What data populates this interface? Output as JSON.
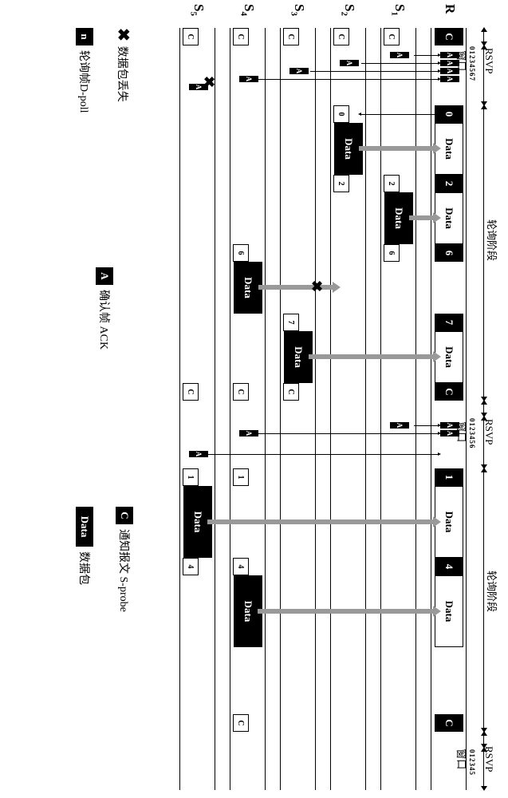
{
  "phases": {
    "rsvp1": {
      "label_top": "RSVP",
      "label_bot": "窗口",
      "ticks": "01234567"
    },
    "poll1": {
      "label": "轮询阶段"
    },
    "rsvp2": {
      "label_top": "RSVP",
      "label_bot": "窗口",
      "ticks": "0123456"
    },
    "poll2": {
      "label": "轮询阶段"
    },
    "rsvp3": {
      "label_top": "RSVP",
      "label_bot": "窗口",
      "ticks": "012345"
    }
  },
  "rows": {
    "R": {
      "label": "R"
    },
    "S1": {
      "label": "S",
      "sub": "1"
    },
    "S2": {
      "label": "S",
      "sub": "2"
    },
    "S3": {
      "label": "S",
      "sub": "3"
    },
    "S4": {
      "label": "S",
      "sub": "4"
    },
    "S5": {
      "label": "S",
      "sub": "5"
    }
  },
  "blocks": {
    "c": "C",
    "data": "Data",
    "a": "A",
    "poll_nums": {
      "n0": "0",
      "n2": "2",
      "n6": "6",
      "n7": "7",
      "n1": "1",
      "n4": "4"
    }
  },
  "legend": {
    "x_loss": "数据包丢失",
    "dpoll": "轮询帧D-poll",
    "dpoll_sym": "n",
    "ack": "确认帧 ACK",
    "ack_sym": "A",
    "sprobe": "通知报文 S-probe",
    "sprobe_sym": "C",
    "datapkt": "数据包",
    "datapkt_sym": "Data"
  },
  "chart_data": {
    "type": "timing-diagram-mac-protocol",
    "entities": [
      "R",
      "S1",
      "S2",
      "S3",
      "S4",
      "S5"
    ],
    "sequence": [
      {
        "phase": "RSVP窗口",
        "R_sends": "C",
        "ack_replies_from": [
          "S1",
          "S2",
          "S3",
          "S4",
          "S5"
        ],
        "lost_ack_from": [
          "S5(slot1)"
        ],
        "slots": 8
      },
      {
        "phase": "轮询阶段",
        "events": [
          {
            "R": "D-poll 0",
            "to": "S2",
            "S2_replies": "Data"
          },
          {
            "R": "D-poll 2",
            "to": "S1",
            "S1_replies": "Data",
            "also_rx_by_S2": true
          },
          {
            "R": "D-poll 6",
            "to": "S4",
            "S4_replies": "Data",
            "lost": true,
            "also_rx_by_S1": true
          },
          {
            "R": "D-poll 7",
            "to": "S3",
            "S3_replies": "Data"
          },
          {
            "R": "C",
            "rx_by": [
              "S3",
              "S4",
              "S5"
            ]
          }
        ]
      },
      {
        "phase": "RSVP窗口",
        "ack_replies_from": [
          "S1",
          "S4",
          "S5"
        ],
        "slots": 7
      },
      {
        "phase": "轮询阶段",
        "events": [
          {
            "R": "D-poll 1",
            "to": "S5",
            "S5_replies": "Data",
            "also_rx_by_S4": true
          },
          {
            "R": "D-poll 4",
            "to": "S4",
            "S4_replies": "Data",
            "also_rx_by_S5": true
          },
          {
            "R": "C",
            "rx_by": [
              "S4"
            ]
          }
        ]
      },
      {
        "phase": "RSVP窗口",
        "slots": 6
      }
    ]
  }
}
